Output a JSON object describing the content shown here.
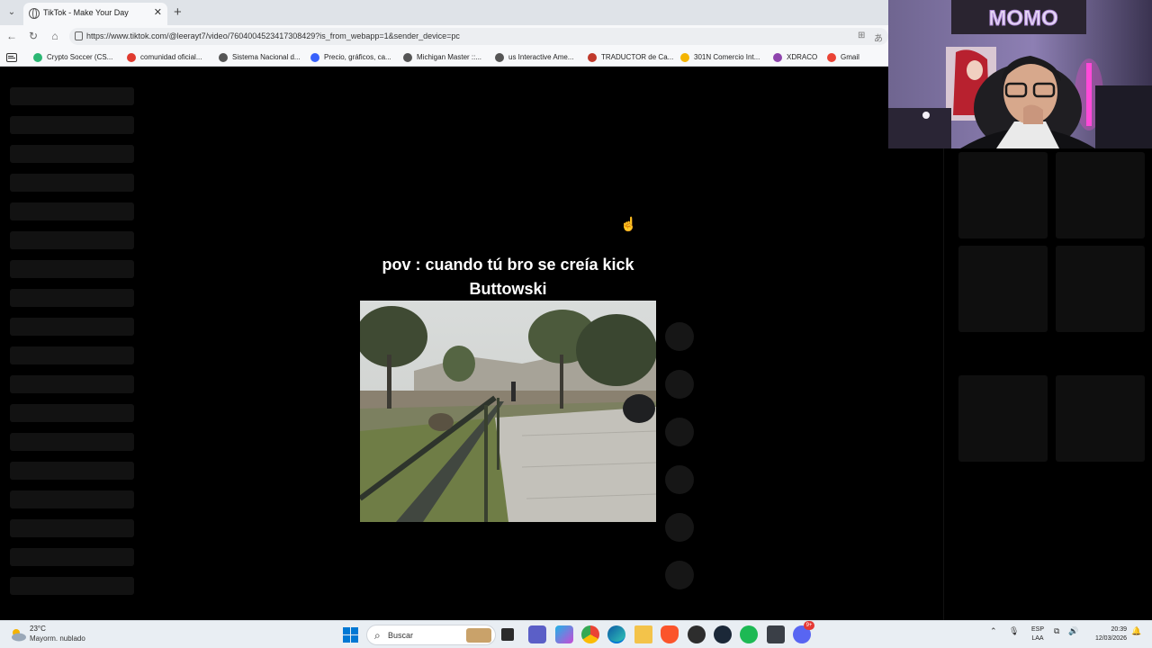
{
  "browser": {
    "tab_title": "TikTok - Make Your Day",
    "url": "https://www.tiktok.com/@leerayt7/video/7604004523417308429?is_from_webapp=1&sender_device=pc",
    "bookmarks": [
      {
        "label": "Crypto Soccer (CS...",
        "icon": "crypto-soccer-icon",
        "color": "#2bb673"
      },
      {
        "label": "comunidad oficial...",
        "icon": "comunidad-icon",
        "color": "#e03a2f"
      },
      {
        "label": "Sistema Nacional d...",
        "icon": "flame-icon",
        "color": "#555555"
      },
      {
        "label": "Precio, gráficos, ca...",
        "icon": "coinmarketcap-icon",
        "color": "#3861fb"
      },
      {
        "label": "Michigan Master ::...",
        "icon": "globe-icon",
        "color": "#555555"
      },
      {
        "label": "us Interactive Ame...",
        "icon": "globe-icon",
        "color": "#555555"
      },
      {
        "label": "TRADUCTOR de Ca...",
        "icon": "traductor-icon",
        "color": "#c0392b"
      },
      {
        "label": "301N Comercio Int...",
        "icon": "drive-icon",
        "color": "#f4b400"
      },
      {
        "label": "XDRACO",
        "icon": "x-icon",
        "color": "#8e44ad"
      },
      {
        "label": "Gmail",
        "icon": "gmail-icon",
        "color": "#ea4335"
      }
    ]
  },
  "video": {
    "caption": "pov : cuando tú bro se creía kick Buttowski"
  },
  "webcam": {
    "sign_text": "MOMO"
  },
  "taskbar": {
    "temperature": "23°C",
    "weather": "Mayorm. nublado",
    "search_label": "Buscar",
    "lang_line1": "ESP",
    "lang_line2": "LAA",
    "time": "20:39",
    "date": "12/03/2026",
    "notification_badge": "9+"
  },
  "colors": {
    "tab_bar": "#dfe3e8",
    "toolbar": "#f7f8fa",
    "page_bg": "#000000",
    "skeleton": "#121212",
    "taskbar": "#e9eef3"
  }
}
